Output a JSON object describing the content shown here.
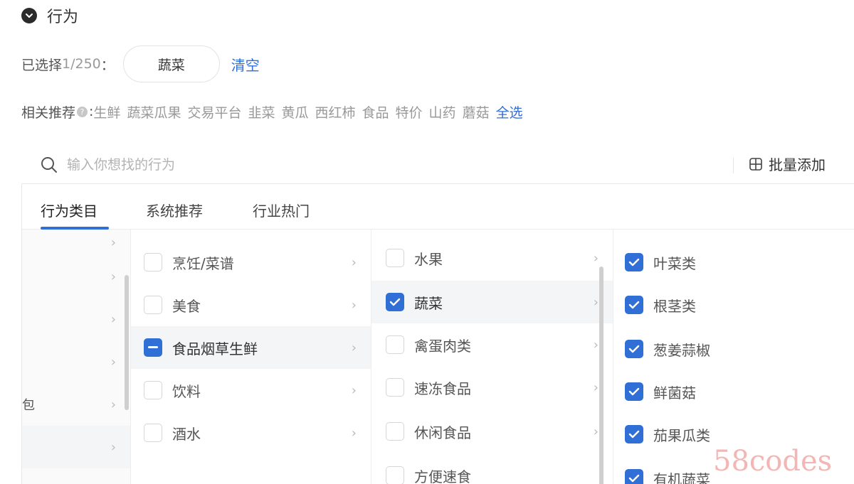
{
  "section": {
    "title": "行为",
    "toggle_icon": "chevron-down-circle-icon"
  },
  "selected": {
    "label": "已选择",
    "count": "1/250",
    "colon": "：",
    "tags": [
      "蔬菜"
    ],
    "clear_label": "清空"
  },
  "recommend": {
    "label": "相关推荐",
    "help_icon": "question-circle-icon",
    "colon": ":",
    "items": [
      "生鲜",
      "蔬菜瓜果",
      "交易平台",
      "韭菜",
      "黄瓜",
      "西红柿",
      "食品",
      "特价",
      "山药",
      "蘑菇"
    ],
    "select_all_label": "全选"
  },
  "search": {
    "placeholder": "输入你想找的行为",
    "icon": "search-icon"
  },
  "batch_add": {
    "label": "批量添加",
    "icon": "batch-add-icon"
  },
  "tabs": [
    {
      "label": "行为类目",
      "active": true
    },
    {
      "label": "系统推荐",
      "active": false
    },
    {
      "label": "行业热门",
      "active": false
    }
  ],
  "column1": {
    "fragment": "包"
  },
  "column2": [
    {
      "label": "烹饪/菜谱",
      "state": "unchecked"
    },
    {
      "label": "美食",
      "state": "unchecked"
    },
    {
      "label": "食品烟草生鲜",
      "state": "partial"
    },
    {
      "label": "饮料",
      "state": "unchecked"
    },
    {
      "label": "酒水",
      "state": "unchecked"
    }
  ],
  "column3": [
    {
      "label": "水果",
      "state": "unchecked"
    },
    {
      "label": "蔬菜",
      "state": "checked"
    },
    {
      "label": "禽蛋肉类",
      "state": "unchecked"
    },
    {
      "label": "速冻食品",
      "state": "unchecked"
    },
    {
      "label": "休闲食品",
      "state": "unchecked"
    },
    {
      "label": "方便速食",
      "state": "unchecked"
    }
  ],
  "column4": [
    {
      "label": "叶菜类",
      "state": "checked"
    },
    {
      "label": "根茎类",
      "state": "checked"
    },
    {
      "label": "葱姜蒜椒",
      "state": "checked"
    },
    {
      "label": "鲜菌菇",
      "state": "checked"
    },
    {
      "label": "茄果瓜类",
      "state": "checked"
    },
    {
      "label": "有机蔬菜",
      "state": "checked"
    }
  ],
  "chevron_glyph": "›",
  "accent_color": "#2f6fd6",
  "watermark": "58codes"
}
